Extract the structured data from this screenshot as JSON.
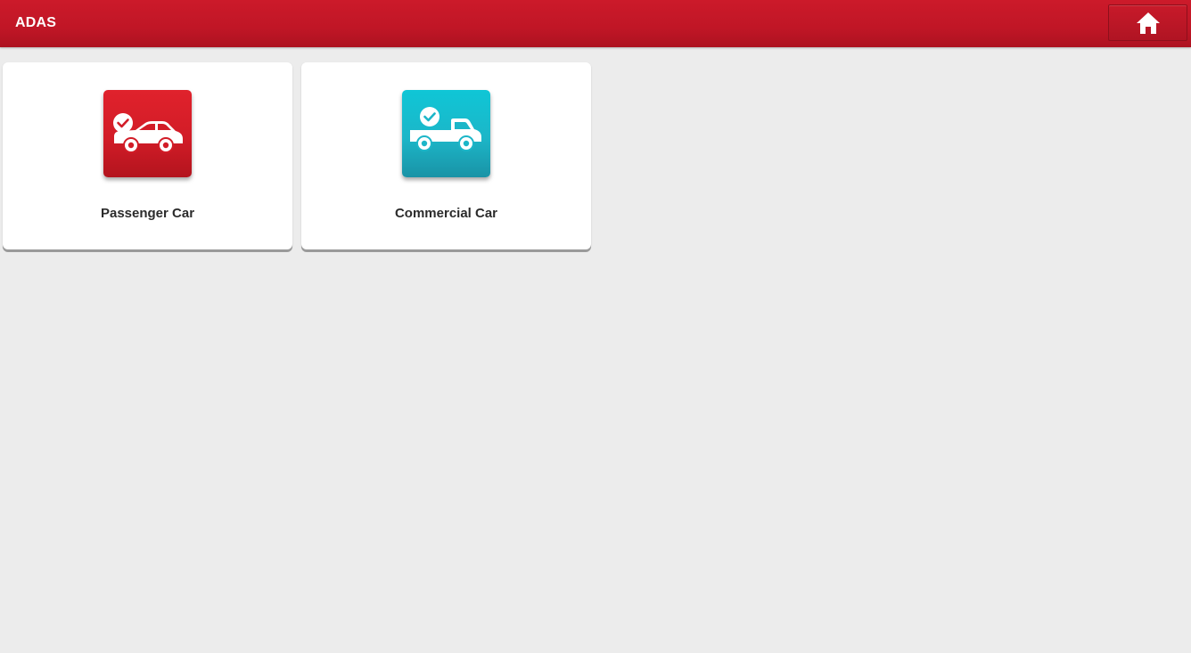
{
  "header": {
    "title": "ADAS",
    "home_icon": "home-icon",
    "accent_color": "#c01626"
  },
  "cards": [
    {
      "label": "Passenger Car",
      "icon": "passenger-car-icon",
      "tile_color": "#d21c27"
    },
    {
      "label": "Commercial Car",
      "icon": "commercial-car-icon",
      "tile_color": "#1cb6c8"
    }
  ]
}
